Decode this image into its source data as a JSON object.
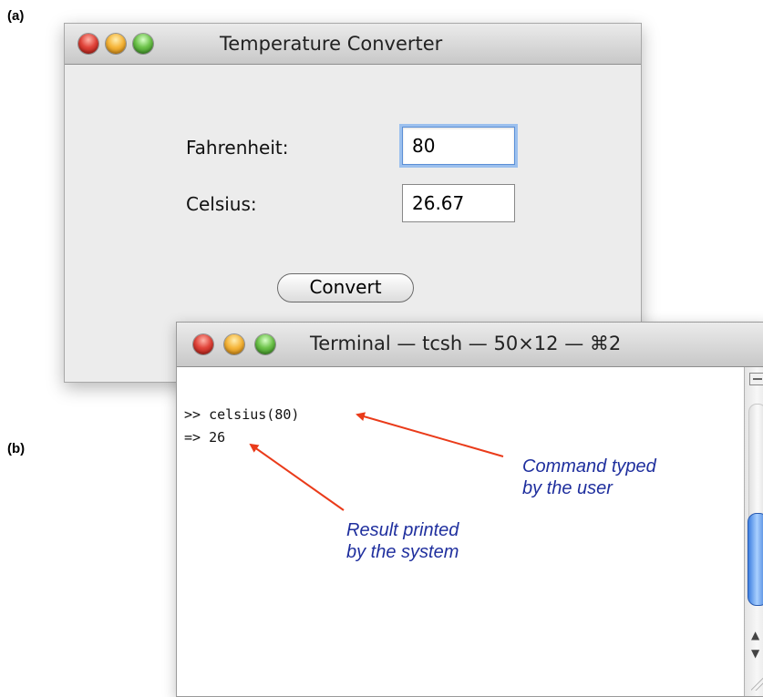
{
  "panel_labels": {
    "a": "(a)",
    "b": "(b)"
  },
  "converter_window": {
    "title": "Temperature Converter",
    "fahrenheit_label": "Fahrenheit:",
    "fahrenheit_value": "80",
    "celsius_label": "Celsius:",
    "celsius_value": "26.67",
    "convert_button": "Convert"
  },
  "terminal_window": {
    "title": "Terminal — tcsh — 50×12 — ⌘2",
    "lines": [
      ">> celsius(80)",
      "=> 26"
    ]
  },
  "annotations": {
    "command": [
      "Command typed",
      "by the user"
    ],
    "result": [
      "Result printed",
      "by the system"
    ]
  },
  "colors": {
    "annotation_text": "#1f2f9e",
    "arrow": "#ea3b1a",
    "scroll_thumb": "#3d7fe0"
  }
}
